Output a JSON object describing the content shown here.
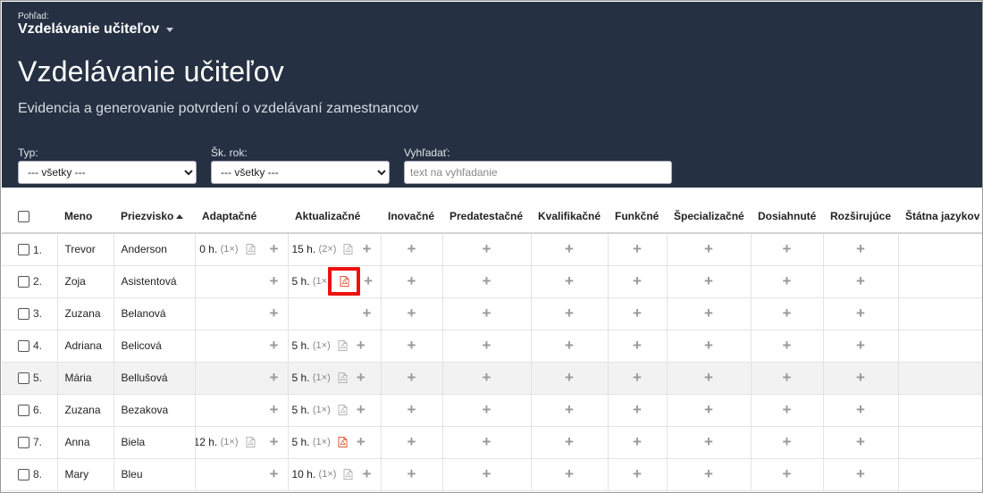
{
  "header": {
    "view_label": "Pohľad:",
    "view_value": "Vzdelávanie učiteľov",
    "title": "Vzdelávanie učiteľov",
    "subtitle": "Evidencia a generovanie potvrdení o vzdelávaní zamestnancov"
  },
  "filters": {
    "type_label": "Typ:",
    "type_value": "--- všetky ---",
    "year_label": "Šk. rok:",
    "year_value": "--- všetky ---",
    "search_label": "Vyhľadať:",
    "search_placeholder": "text na vyhľadanie"
  },
  "columns": [
    "Meno",
    "Priezvisko",
    "Adaptačné",
    "Aktualizačné",
    "Inovačné",
    "Predatestačné",
    "Kvalifikačné",
    "Funkčné",
    "Špecializačné",
    "Dosiahnuté",
    "Rozširujúce",
    "Štátna jazykov"
  ],
  "sort": {
    "column": "Priezvisko",
    "direction": "asc"
  },
  "rows": [
    {
      "num": "1.",
      "first": "Trevor",
      "last": "Anderson",
      "adapt_h": "0 h.",
      "adapt_c": "(1×)",
      "aktual_h": "15 h.",
      "aktual_c": "(2×)"
    },
    {
      "num": "2.",
      "first": "Zoja",
      "last": "Asistentová",
      "adapt_h": "",
      "adapt_c": "",
      "aktual_h": "5 h.",
      "aktual_c": "(1×"
    },
    {
      "num": "3.",
      "first": "Zuzana",
      "last": "Belanová",
      "adapt_h": "",
      "adapt_c": "",
      "aktual_h": "",
      "aktual_c": ""
    },
    {
      "num": "4.",
      "first": "Adriana",
      "last": "Belicová",
      "adapt_h": "",
      "adapt_c": "",
      "aktual_h": "5 h.",
      "aktual_c": "(1×)"
    },
    {
      "num": "5.",
      "first": "Mária",
      "last": "Bellušová",
      "adapt_h": "",
      "adapt_c": "",
      "aktual_h": "5 h.",
      "aktual_c": "(1×)"
    },
    {
      "num": "6.",
      "first": "Zuzana",
      "last": "Bezakova",
      "adapt_h": "",
      "adapt_c": "",
      "aktual_h": "5 h.",
      "aktual_c": "(1×)"
    },
    {
      "num": "7.",
      "first": "Anna",
      "last": "Biela",
      "adapt_h": "12 h.",
      "adapt_c": "(1×)",
      "aktual_h": "5 h.",
      "aktual_c": "(1×)"
    },
    {
      "num": "8.",
      "first": "Mary",
      "last": "Bleu",
      "adapt_h": "",
      "adapt_c": "",
      "aktual_h": "10 h.",
      "aktual_c": "(1×)"
    }
  ],
  "colors": {
    "header_bg": "#253142",
    "pdf_active": "#e05a3a",
    "pdf_inactive": "#b5b5b5",
    "highlight": "#e11111"
  },
  "icons": {
    "pdf": "pdf-file-icon",
    "add": "plus-icon",
    "sort": "sort-ascending-icon",
    "view_dropdown": "chevron-down-icon"
  }
}
